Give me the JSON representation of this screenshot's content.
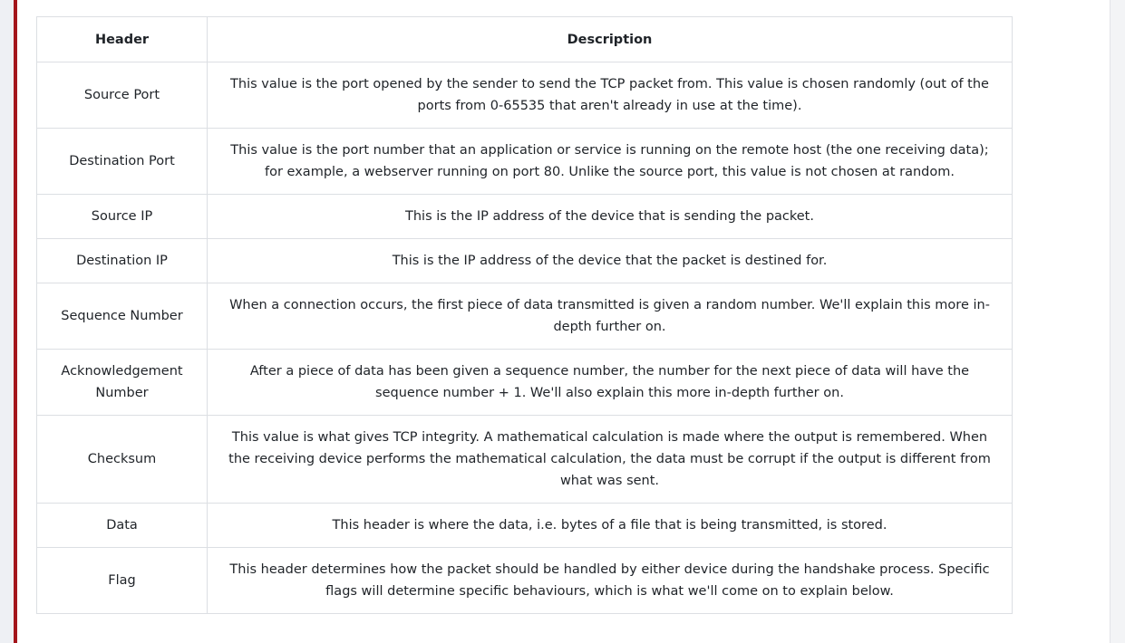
{
  "table": {
    "headers": [
      "Header",
      "Description"
    ],
    "rows": [
      {
        "header": "Source Port",
        "description": "This value is the port opened by the sender to send the TCP packet from. This value is chosen randomly (out of the ports from 0-65535 that aren't already in use at the time)."
      },
      {
        "header": "Destination Port",
        "description": "This value is the port number that an application or service is running on the remote host (the one receiving data); for example, a webserver running on port 80. Unlike the source port, this value is not chosen at random."
      },
      {
        "header": "Source IP",
        "description": "This is the IP address of the device that is sending the packet."
      },
      {
        "header": "Destination IP",
        "description": "This is the IP address of the device that the packet is destined for."
      },
      {
        "header": "Sequence Number",
        "description": "When a connection occurs, the first piece of data transmitted is given a random number. We'll explain this more in-depth further on."
      },
      {
        "header": "Acknowledgement Number",
        "description": "After a piece of data has been given a sequence number, the number for the next piece of data will have the sequence number + 1. We'll also explain this more in-depth further on."
      },
      {
        "header": "Checksum",
        "description": "This value is what gives TCP integrity. A mathematical calculation is made where the output is remembered. When the receiving device performs the mathematical calculation, the data must be corrupt if the output is different from what was sent."
      },
      {
        "header": "Data",
        "description": "This header is where the data, i.e. bytes of a file that is being transmitted, is stored."
      },
      {
        "header": "Flag",
        "description": "This header determines how the packet should be handled by either device during the handshake process. Specific flags will determine specific behaviours, which is what we'll come on to explain below."
      }
    ]
  }
}
